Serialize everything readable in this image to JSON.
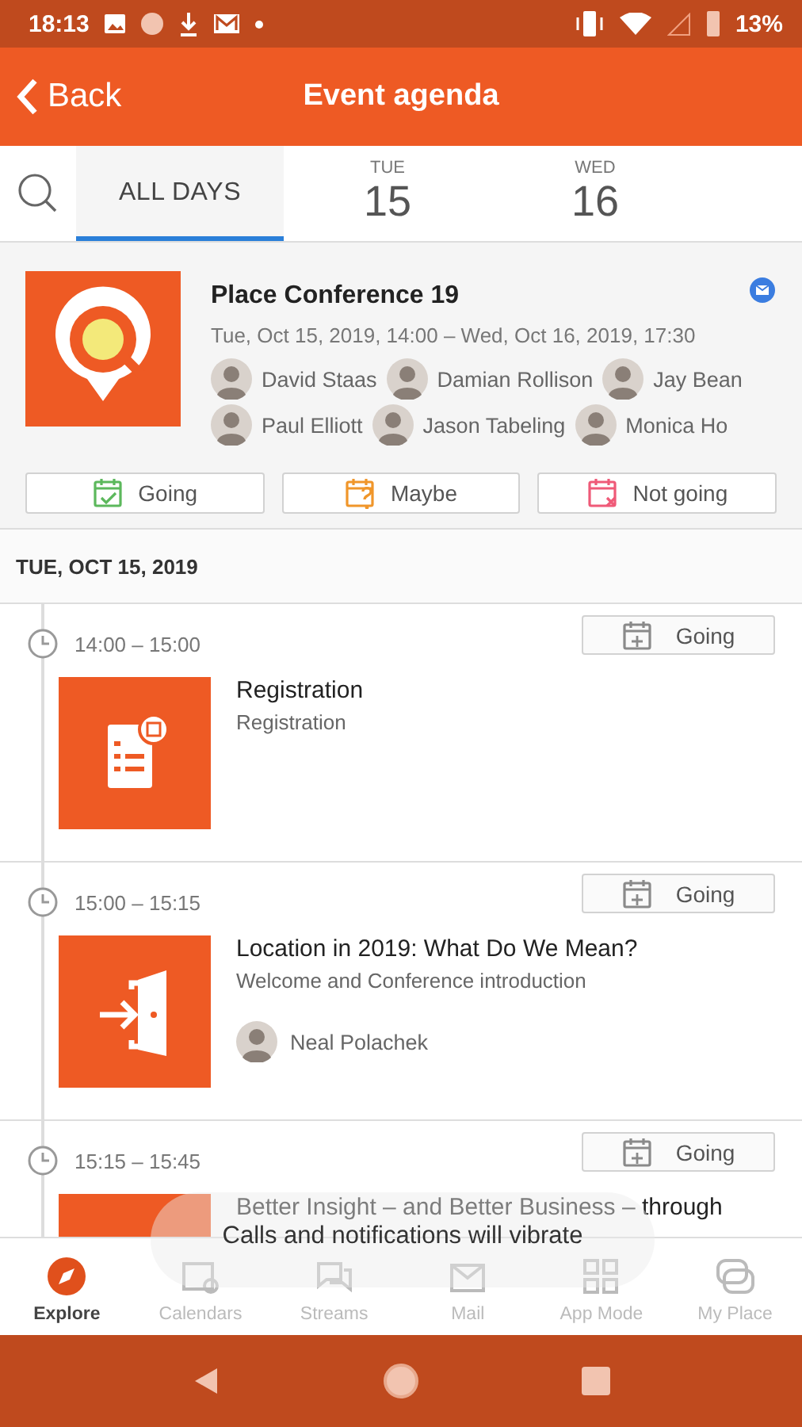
{
  "status_bar": {
    "time": "18:13",
    "battery": "13%"
  },
  "app_bar": {
    "back": "Back",
    "title": "Event agenda"
  },
  "day_tabs": [
    {
      "kind": "all",
      "label": "ALL DAYS",
      "selected": true
    },
    {
      "kind": "day",
      "weekday": "TUE",
      "day": "15",
      "selected": false
    },
    {
      "kind": "day",
      "weekday": "WED",
      "day": "16",
      "selected": false
    }
  ],
  "event": {
    "title": "Place Conference 19",
    "dates": "Tue, Oct 15, 2019, 14:00 – Wed, Oct 16, 2019, 17:30",
    "attendees": [
      "David Staas",
      "Damian Rollison",
      "Jay Bean",
      "Paul Elliott",
      "Jason Tabeling",
      "Monica Ho"
    ],
    "rsvp": [
      {
        "kind": "going",
        "label": "Going"
      },
      {
        "kind": "maybe",
        "label": "Maybe"
      },
      {
        "kind": "not-going",
        "label": "Not going"
      }
    ]
  },
  "agenda": {
    "day_header": "TUE, OCT 15, 2019",
    "sessions": [
      {
        "time": "14:00 – 15:00",
        "rsvp": "Going",
        "kind": "registration",
        "title": "Registration",
        "subtitle": "Registration"
      },
      {
        "time": "15:00 – 15:15",
        "rsvp": "Going",
        "kind": "entrance",
        "title": "Location in 2019: What Do We Mean?",
        "subtitle": "Welcome and Conference introduction",
        "speakers": [
          "Neal Polachek"
        ]
      },
      {
        "time": "15:15 – 15:45",
        "rsvp": "Going",
        "kind": "other",
        "title": "Better Insight – and Better Business – through"
      }
    ]
  },
  "toast": "Calls and notifications will vibrate",
  "bottom_nav": [
    {
      "kind": "explore",
      "label": "Explore",
      "selected": true
    },
    {
      "kind": "calendars",
      "label": "Calendars",
      "selected": false
    },
    {
      "kind": "streams",
      "label": "Streams",
      "selected": false
    },
    {
      "kind": "mail",
      "label": "Mail",
      "selected": false
    },
    {
      "kind": "app-mode",
      "label": "App Mode",
      "selected": false
    },
    {
      "kind": "my-place",
      "label": "My Place",
      "selected": false
    }
  ]
}
